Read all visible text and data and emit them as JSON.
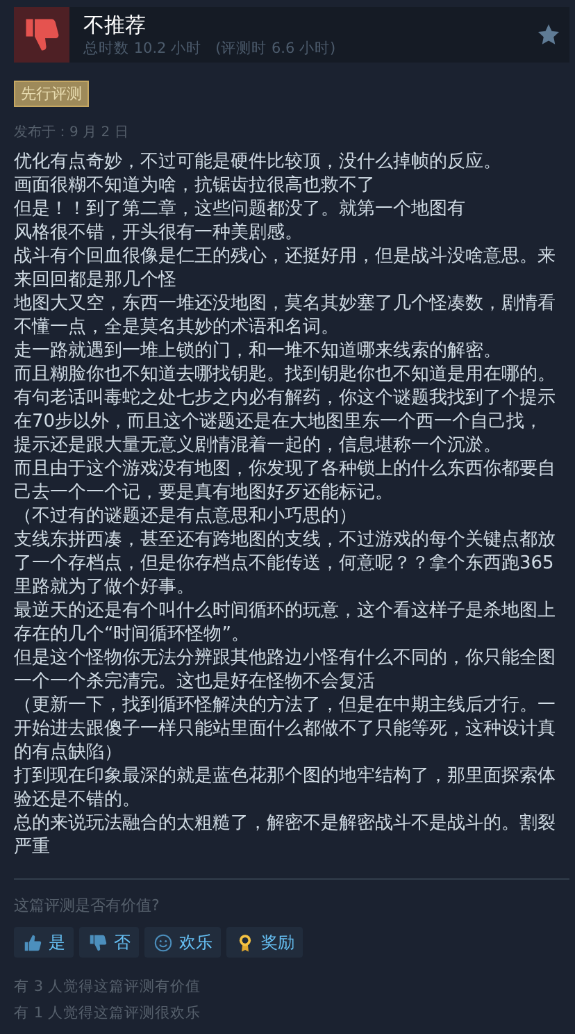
{
  "header": {
    "verdict": "不推荐",
    "recommended": false,
    "hours": "总时数 10.2 小时",
    "hours_at_review": "(评测时 6.6 小时)"
  },
  "badge": "先行评测",
  "posted": "发布于：9 月 2 日",
  "paragraphs": [
    "优化有点奇妙，不过可能是硬件比较顶，没什么掉帧的反应。",
    "画面很糊不知道为啥，抗锯齿拉很高也救不了",
    "但是！！到了第二章，这些问题都没了。就第一个地图有",
    "风格很不错，开头很有一种美剧感。",
    "战斗有个回血很像是仁王的残心，还挺好用，但是战斗没啥意思。来来回回都是那几个怪",
    "地图大又空，东西一堆还没地图，莫名其妙塞了几个怪凑数，剧情看不懂一点，全是莫名其妙的术语和名词。",
    "走一路就遇到一堆上锁的门，和一堆不知道哪来线索的解密。",
    "而且糊脸你也不知道去哪找钥匙。找到钥匙你也不知道是用在哪的。",
    "有句老话叫毒蛇之处七步之内必有解药，你这个谜题我找到了个提示在70步以外，而且这个谜题还是在大地图里东一个西一个自己找，提示还是跟大量无意义剧情混着一起的，信息堪称一个沉淤。",
    "而且由于这个游戏没有地图，你发现了各种锁上的什么东西你都要自己去一个一个记，要是真有地图好歹还能标记。",
    "（不过有的谜题还是有点意思和小巧思的）",
    "支线东拼西凑，甚至还有跨地图的支线，不过游戏的每个关键点都放了一个存档点，但是你存档点不能传送，何意呢？？拿个东西跑365里路就为了做个好事。",
    "最逆天的还是有个叫什么时间循环的玩意，这个看这样子是杀地图上存在的几个“时间循环怪物”。",
    "但是这个怪物你无法分辨跟其他路边小怪有什么不同的，你只能全图一个一个杀完清完。这也是好在怪物不会复活",
    "（更新一下，找到循环怪解决的方法了，但是在中期主线后才行。一开始进去跟傻子一样只能站里面什么都做不了只能等死，这种设计真的有点缺陷）",
    "打到现在印象最深的就是蓝色花那个图的地牢结构了，那里面探索体验还是不错的。",
    "总的来说玩法融合的太粗糙了，解密不是解密战斗不是战斗的。割裂严重"
  ],
  "question": "这篇评测是否有价值?",
  "buttons": [
    {
      "kind": "yes",
      "label": "是"
    },
    {
      "kind": "no",
      "label": "否"
    },
    {
      "kind": "funny",
      "label": "欢乐"
    },
    {
      "kind": "award",
      "label": "奖励"
    }
  ],
  "stats": [
    "有 3 人觉得这篇评测有价值",
    "有 1 人觉得这篇评测很欢乐"
  ]
}
